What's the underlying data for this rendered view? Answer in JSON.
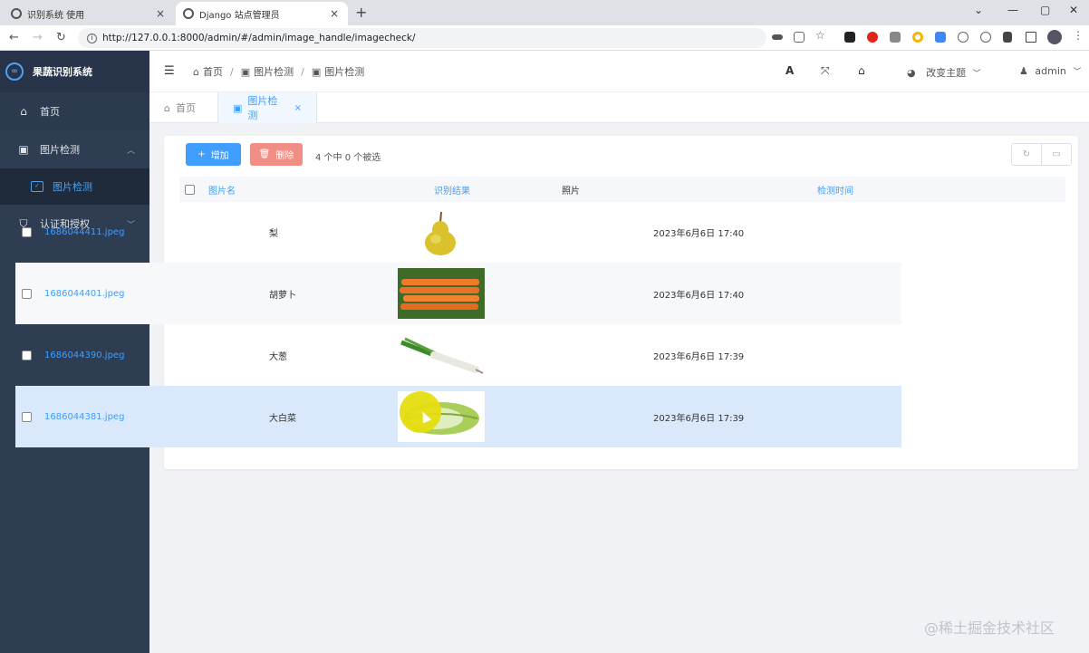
{
  "browser": {
    "tabs": [
      {
        "title": "识别系统 使用"
      },
      {
        "title": "Django 站点管理员"
      }
    ],
    "url": "http://127.0.0.1:8000/admin/#/admin/image_handle/imagecheck/"
  },
  "sidebar": {
    "logo_text": "果蔬识别系统",
    "items": [
      {
        "label": "首页",
        "icon": "home-icon"
      },
      {
        "label": "图片检测",
        "icon": "image-icon"
      },
      {
        "label": "图片检测",
        "icon": "image-icon"
      },
      {
        "label": "认证和授权",
        "icon": "shield-icon"
      }
    ]
  },
  "header": {
    "breadcrumb": [
      "首页",
      "图片检测",
      "图片检测"
    ],
    "theme_label": "改变主题",
    "user_label": "admin"
  },
  "page_tabs": [
    {
      "label": "首页"
    },
    {
      "label": "图片检测"
    }
  ],
  "toolbar": {
    "add_label": "增加",
    "delete_label": "删除",
    "selection_info": "4 个中 0 个被选"
  },
  "table": {
    "headers": [
      "图片名",
      "识别结果",
      "照片",
      "检测时间"
    ],
    "rows": [
      {
        "name": "1686044411.jpeg",
        "result": "梨",
        "photo": "pear",
        "time": "2023年6月6日 17:40"
      },
      {
        "name": "1686044401.jpeg",
        "result": "胡萝卜",
        "photo": "carrot",
        "time": "2023年6月6日 17:40"
      },
      {
        "name": "1686044390.jpeg",
        "result": "大葱",
        "photo": "scallion",
        "time": "2023年6月6日 17:39"
      },
      {
        "name": "1686044381.jpeg",
        "result": "大白菜",
        "photo": "cabbage",
        "time": "2023年6月6日 17:39"
      }
    ]
  },
  "watermark": "@稀土掘金技术社区",
  "colors": {
    "accent": "#409eff",
    "sidebar": "#2f3d52",
    "danger": "#f08e86",
    "highlight_row": "#d9e8fb"
  }
}
